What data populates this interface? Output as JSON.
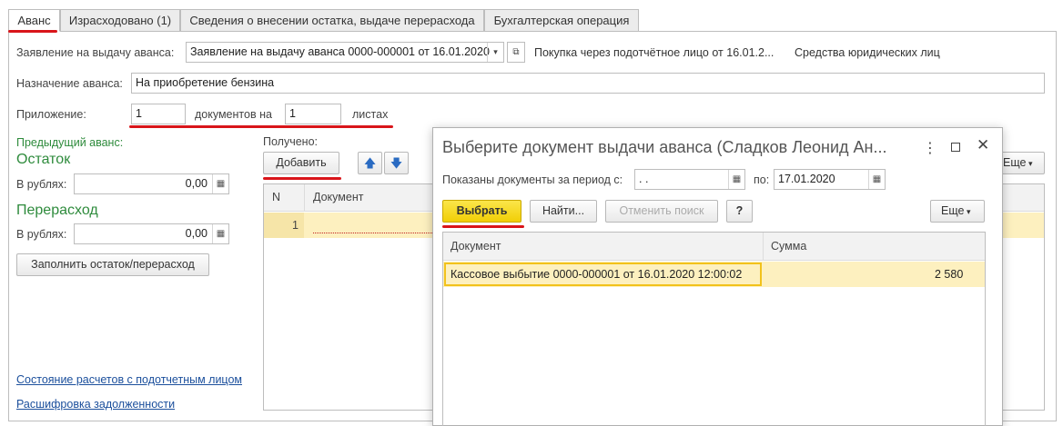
{
  "tabs": [
    {
      "label": "Аванс"
    },
    {
      "label": "Израсходовано (1)"
    },
    {
      "label": "Сведения о внесении остатка, выдаче перерасхода"
    },
    {
      "label": "Бухгалтерская операция"
    }
  ],
  "form": {
    "request_label": "Заявление на выдачу аванса:",
    "request_value": "Заявление на выдачу аванса 0000-000001 от 16.01.2020",
    "purchase_text": "Покупка через подотчётное лицо от 16.01.2...",
    "funds_text": "Средства юридических лиц",
    "purpose_label": "Назначение аванса:",
    "purpose_value": "На приобретение бензина",
    "attach_label": "Приложение:",
    "attach_docs": "1",
    "docs_on": "документов на",
    "attach_sheets": "1",
    "sheets": "листах",
    "prev_advance": "Предыдущий аванс:",
    "balance_title": "Остаток",
    "rub_label": "В рублях:",
    "balance_value": "0,00",
    "overrun_title": "Перерасход",
    "overrun_value": "0,00",
    "fill_button": "Заполнить остаток/перерасход",
    "received_label": "Получено:",
    "add_button": "Добавить",
    "more_button": "Еще",
    "table_col_n": "N",
    "table_col_doc": "Документ",
    "row_n": "1",
    "link_settlements": "Состояние расчетов с подотчетным лицом",
    "link_debt": "Расшифровка задолженности"
  },
  "dialog": {
    "title": "Выберите документ выдачи аванса (Сладков Леонид Ан...",
    "period_label": "Показаны документы за период с:",
    "date_from": " .  .",
    "to_label": "по:",
    "date_to": "17.01.2020",
    "select_button": "Выбрать",
    "find_button": "Найти...",
    "cancel_search_button": "Отменить поиск",
    "help_button": "?",
    "more_button": "Еще",
    "col_document": "Документ",
    "col_sum": "Сумма",
    "rows": [
      {
        "document": "Кассовое выбытие 0000-000001 от 16.01.2020 12:00:02",
        "sum": "2 580"
      }
    ]
  },
  "colors": {
    "accent_red": "#d9151a",
    "select_yellow": "#f5d80f",
    "row_highlight": "#fdf0bf",
    "link_blue": "#1b4f9c",
    "section_green": "#2e8b3c"
  }
}
